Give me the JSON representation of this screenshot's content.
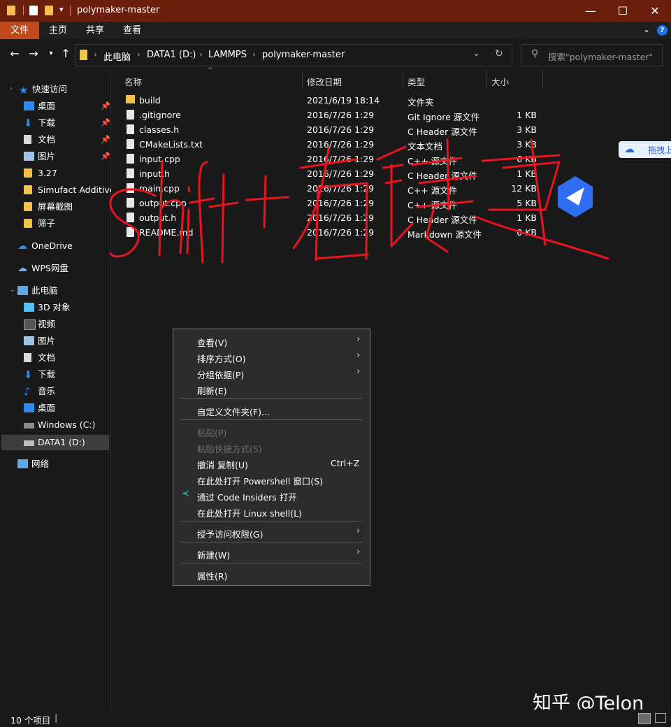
{
  "window": {
    "title": "polymaker-master",
    "controls": {
      "minimize": "—",
      "maximize": "☐",
      "close": "✕"
    }
  },
  "ribbon": {
    "tabs": [
      "文件",
      "主页",
      "共享",
      "查看"
    ],
    "help": "?"
  },
  "address": {
    "crumbs": [
      "此电脑",
      "DATA1 (D:)",
      "LAMMPS",
      "polymaker-master"
    ]
  },
  "search": {
    "placeholder": "搜索\"polymaker-master\""
  },
  "sidebar": {
    "quick_access": "快速访问",
    "items": [
      {
        "label": "桌面",
        "pinned": true,
        "icon": "desktop-icon"
      },
      {
        "label": "下载",
        "pinned": true,
        "icon": "download-icon"
      },
      {
        "label": "文档",
        "pinned": true,
        "icon": "document-icon"
      },
      {
        "label": "图片",
        "pinned": true,
        "icon": "picture-icon"
      },
      {
        "label": "3.27",
        "pinned": false,
        "icon": "folder-icon"
      },
      {
        "label": "Simufact Additive",
        "pinned": false,
        "icon": "folder-icon"
      },
      {
        "label": "屏幕截图",
        "pinned": false,
        "icon": "folder-icon"
      },
      {
        "label": "筛子",
        "pinned": false,
        "icon": "folder-icon"
      }
    ],
    "onedrive": "OneDrive",
    "wps": "WPS网盘",
    "this_pc": "此电脑",
    "pc_items": [
      {
        "label": "3D 对象",
        "icon": "3d-objects-icon"
      },
      {
        "label": "视频",
        "icon": "video-icon"
      },
      {
        "label": "图片",
        "icon": "picture-icon"
      },
      {
        "label": "文档",
        "icon": "document-icon"
      },
      {
        "label": "下载",
        "icon": "download-icon"
      },
      {
        "label": "音乐",
        "icon": "music-icon"
      },
      {
        "label": "桌面",
        "icon": "desktop-icon"
      },
      {
        "label": "Windows (C:)",
        "icon": "drive-icon"
      },
      {
        "label": "DATA1 (D:)",
        "icon": "drive-icon"
      }
    ],
    "network": "网络"
  },
  "columns": {
    "name": "名称",
    "modified": "修改日期",
    "type": "类型",
    "size": "大小"
  },
  "files": [
    {
      "name": "build",
      "modified": "2021/6/19 18:14",
      "type": "文件夹",
      "size": "",
      "kind": "folder"
    },
    {
      "name": ".gitignore",
      "modified": "2016/7/26 1:29",
      "type": "Git Ignore 源文件",
      "size": "1 KB",
      "kind": "file"
    },
    {
      "name": "classes.h",
      "modified": "2016/7/26 1:29",
      "type": "C Header 源文件",
      "size": "3 KB",
      "kind": "file"
    },
    {
      "name": "CMakeLists.txt",
      "modified": "2016/7/26 1:29",
      "type": "文本文档",
      "size": "3 KB",
      "kind": "file"
    },
    {
      "name": "input.cpp",
      "modified": "2016/7/26 1:29",
      "type": "C++ 源文件",
      "size": "6 KB",
      "kind": "file"
    },
    {
      "name": "input.h",
      "modified": "2016/7/26 1:29",
      "type": "C Header 源文件",
      "size": "1 KB",
      "kind": "file"
    },
    {
      "name": "main.cpp",
      "modified": "2016/7/26 1:29",
      "type": "C++ 源文件",
      "size": "12 KB",
      "kind": "file"
    },
    {
      "name": "output.cpp",
      "modified": "2016/7/26 1:29",
      "type": "C++ 源文件",
      "size": "5 KB",
      "kind": "file"
    },
    {
      "name": "output.h",
      "modified": "2016/7/26 1:29",
      "type": "C Header 源文件",
      "size": "1 KB",
      "kind": "file"
    },
    {
      "name": "README.md",
      "modified": "2016/7/26 1:29",
      "type": "Markdown 源文件",
      "size": "0 KB",
      "kind": "file"
    }
  ],
  "context_menu": {
    "view": "查看(V)",
    "sort": "排序方式(O)",
    "group": "分组依据(P)",
    "refresh": "刷新(E)",
    "customize": "自定义文件夹(F)...",
    "paste": "粘贴(P)",
    "paste_shortcut": "粘贴快捷方式(S)",
    "undo_copy": "撤消 复制(U)",
    "undo_shortcut": "Ctrl+Z",
    "powershell": "在此处打开 Powershell 窗口(S)",
    "code_insiders": "通过 Code Insiders 打开",
    "linux_shell": "在此处打开 Linux shell(L)",
    "grant_access": "授予访问权限(G)",
    "new": "新建(W)",
    "properties": "属性(R)"
  },
  "status": {
    "count": "10 个项目"
  },
  "overlay": {
    "handwriting": "shift+右键",
    "drag_upload": "拖拽上",
    "watermark": "知乎 @Telon"
  },
  "colors": {
    "titlebar": "#6b1e0b",
    "file_tab": "#c14a1c",
    "annotation": "#e8141e",
    "folder": "#f2c14e"
  }
}
